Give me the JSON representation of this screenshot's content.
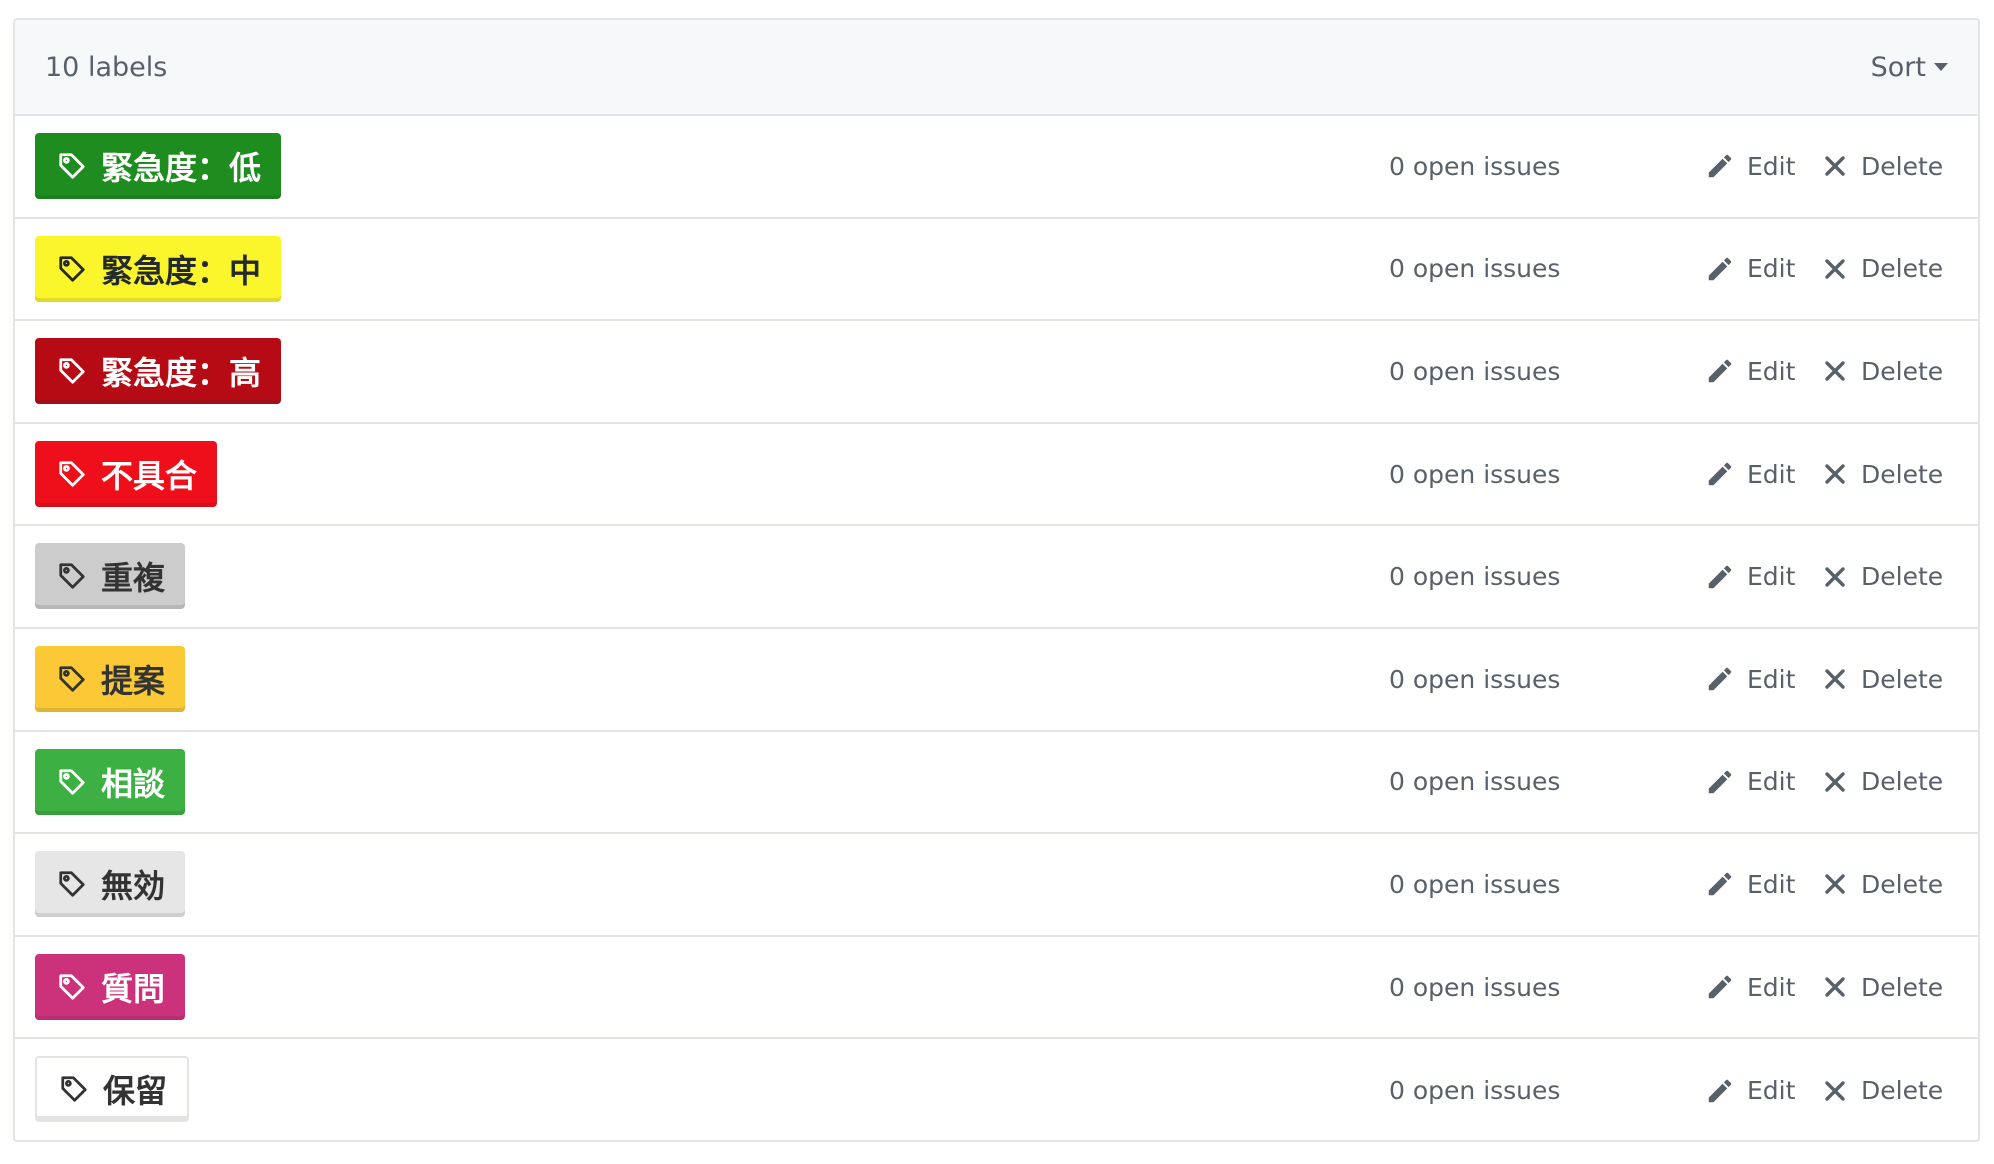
{
  "header": {
    "count_text": "10 labels",
    "sort_label": "Sort"
  },
  "labels": [
    {
      "name": "緊急度：低",
      "bg": "#1e8c1e",
      "fg": "#ffffff",
      "issues": "0 open issues",
      "edit": "Edit",
      "delete": "Delete"
    },
    {
      "name": "緊急度：中",
      "bg": "#fbf62b",
      "fg": "#24292e",
      "issues": "0 open issues",
      "edit": "Edit",
      "delete": "Delete"
    },
    {
      "name": "緊急度：高",
      "bg": "#b60b15",
      "fg": "#ffffff",
      "issues": "0 open issues",
      "edit": "Edit",
      "delete": "Delete"
    },
    {
      "name": "不具合",
      "bg": "#ee0f1b",
      "fg": "#ffffff",
      "issues": "0 open issues",
      "edit": "Edit",
      "delete": "Delete"
    },
    {
      "name": "重複",
      "bg": "#cccccc",
      "fg": "#333333",
      "issues": "0 open issues",
      "edit": "Edit",
      "delete": "Delete"
    },
    {
      "name": "提案",
      "bg": "#fbc935",
      "fg": "#333333",
      "issues": "0 open issues",
      "edit": "Edit",
      "delete": "Delete"
    },
    {
      "name": "相談",
      "bg": "#3db043",
      "fg": "#ffffff",
      "issues": "0 open issues",
      "edit": "Edit",
      "delete": "Delete"
    },
    {
      "name": "無効",
      "bg": "#e6e6e6",
      "fg": "#333333",
      "issues": "0 open issues",
      "edit": "Edit",
      "delete": "Delete"
    },
    {
      "name": "質問",
      "bg": "#cc317c",
      "fg": "#ffffff",
      "issues": "0 open issues",
      "edit": "Edit",
      "delete": "Delete"
    },
    {
      "name": "保留",
      "bg": "#ffffff",
      "fg": "#333333",
      "issues": "0 open issues",
      "edit": "Edit",
      "delete": "Delete"
    }
  ],
  "icons": {
    "label": "tag-icon",
    "edit": "pencil-icon",
    "delete": "x-icon",
    "sort": "caret-down-icon"
  }
}
